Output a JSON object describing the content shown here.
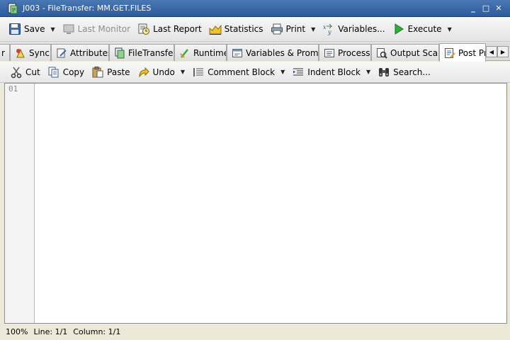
{
  "window": {
    "title": "J003 - FileTransfer: MM.GET.FILES",
    "minimize": "_",
    "maximize": "□",
    "close": "✕"
  },
  "toolbar": {
    "save": "Save",
    "last_monitor": "Last Monitor",
    "last_report": "Last Report",
    "statistics": "Statistics",
    "print": "Print",
    "variables": "Variables...",
    "execute": "Execute"
  },
  "tabs": [
    {
      "label": "r"
    },
    {
      "label": "Sync"
    },
    {
      "label": "Attributes"
    },
    {
      "label": "FileTransfer"
    },
    {
      "label": "Runtime"
    },
    {
      "label": "Variables & Prompts"
    },
    {
      "label": "Process"
    },
    {
      "label": "Output Scan"
    },
    {
      "label": "Post Pro"
    }
  ],
  "edit_toolbar": {
    "cut": "Cut",
    "copy": "Copy",
    "paste": "Paste",
    "undo": "Undo",
    "comment_block": "Comment Block",
    "indent_block": "Indent Block",
    "search": "Search..."
  },
  "editor": {
    "first_line_number": "01"
  },
  "status": {
    "zoom": "100%",
    "line": "Line: 1/1",
    "column": "Column: 1/1"
  }
}
